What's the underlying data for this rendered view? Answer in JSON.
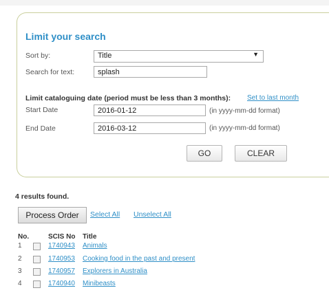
{
  "search_panel": {
    "title": "Limit your search",
    "sort_by_label": "Sort by:",
    "sort_by_value": "Title",
    "search_text_label": "Search for text:",
    "search_text_value": "splash",
    "limit_heading": "Limit cataloguing date (period must be less than 3 months):",
    "limit_link": "Set to last month",
    "start_date_label": "Start Date",
    "start_date_value": "2016-01-12",
    "end_date_label": "End Date",
    "end_date_value": "2016-03-12",
    "date_hint": "(in yyyy-mm-dd format)",
    "go_label": "GO",
    "clear_label": "CLEAR"
  },
  "results": {
    "count_text": "4 results found.",
    "process_order_label": "Process Order",
    "select_all_label": "Select All",
    "unselect_all_label": "Unselect All",
    "columns": {
      "no": "No.",
      "scis_no": "SCIS No",
      "title": "Title"
    },
    "rows": [
      {
        "no": "1",
        "scis_no": "1740943",
        "title": "Animals"
      },
      {
        "no": "2",
        "scis_no": "1740953",
        "title": "Cooking food in the past and present"
      },
      {
        "no": "3",
        "scis_no": "1740957",
        "title": "Explorers in Australia"
      },
      {
        "no": "4",
        "scis_no": "1740940",
        "title": "Minibeasts"
      }
    ]
  }
}
